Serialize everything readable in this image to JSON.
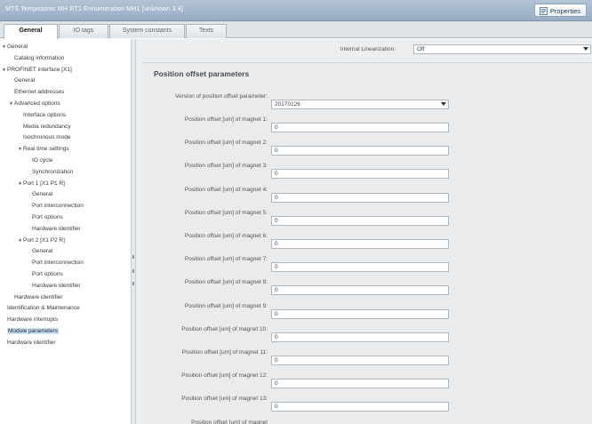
{
  "window": {
    "title": "MTS Temposonic MH RT1 Ennumeration MH1 [unknown 3.4]",
    "properties_label": "Properties",
    "properties_icon": "properties-icon"
  },
  "tabs": [
    {
      "label": "General",
      "active": true
    },
    {
      "label": "IO tags",
      "active": false
    },
    {
      "label": "System constants",
      "active": false
    },
    {
      "label": "Texts",
      "active": false
    }
  ],
  "nav": {
    "items": [
      {
        "label": "General",
        "toggle": "▼"
      },
      {
        "label": "Catalog information",
        "toggle": ""
      },
      {
        "label": "PROFINET interface [X1]",
        "toggle": "▼"
      },
      {
        "label": "General",
        "toggle": ""
      },
      {
        "label": "Ethernet addresses",
        "toggle": ""
      },
      {
        "label": "Advanced options",
        "toggle": "▼"
      },
      {
        "label": "Interface options",
        "toggle": ""
      },
      {
        "label": "Media redundancy",
        "toggle": ""
      },
      {
        "label": "Isochronous mode",
        "toggle": ""
      },
      {
        "label": "Real time settings",
        "toggle": "▼"
      },
      {
        "label": "IO cycle",
        "toggle": ""
      },
      {
        "label": "Synchronization",
        "toggle": ""
      },
      {
        "label": "Port 1 [X1 P1 R]",
        "toggle": "▼"
      },
      {
        "label": "General",
        "toggle": ""
      },
      {
        "label": "Port interconnection",
        "toggle": ""
      },
      {
        "label": "Port options",
        "toggle": ""
      },
      {
        "label": "Hardware identifier",
        "toggle": ""
      },
      {
        "label": "Port 2 [X1 P2 R]",
        "toggle": "▼"
      },
      {
        "label": "General",
        "toggle": ""
      },
      {
        "label": "Port interconnection",
        "toggle": ""
      },
      {
        "label": "Port options",
        "toggle": ""
      },
      {
        "label": "Hardware identifier",
        "toggle": ""
      },
      {
        "label": "Hardware identifier",
        "toggle": ""
      },
      {
        "label": "Identification & Maintenance",
        "toggle": ""
      },
      {
        "label": "Hardware interrupts",
        "toggle": ""
      },
      {
        "label": "Module parameters",
        "toggle": "",
        "selected": true
      },
      {
        "label": "Hardware identifier",
        "toggle": ""
      }
    ]
  },
  "internal_linearization": {
    "label": "Internal Linearization:",
    "value": "Off"
  },
  "section": {
    "title": "Position offset parameters"
  },
  "version": {
    "label": "Version of position offset parameter:",
    "value": "20170126"
  },
  "offsets": [
    {
      "label": "Position offset [um] of magnet 1:",
      "value": "0"
    },
    {
      "label": "Position offset [um] of magnet 2:",
      "value": "0"
    },
    {
      "label": "Position offset [um] of magnet 3:",
      "value": "0"
    },
    {
      "label": "Position offset [um] of magnet 4:",
      "value": "0"
    },
    {
      "label": "Position offset [um] of magnet 5:",
      "value": "0"
    },
    {
      "label": "Position offset [um] of magnet 6:",
      "value": "0"
    },
    {
      "label": "Position offset [um] of magnet 7:",
      "value": "0"
    },
    {
      "label": "Position offset [um] of magnet 8:",
      "value": "0"
    },
    {
      "label": "Position offset [um] of magnet 9:",
      "value": "0"
    },
    {
      "label": "Position offset [um] of magnet 10:",
      "value": "0"
    },
    {
      "label": "Position offset [um] of magnet 11:",
      "value": "0"
    },
    {
      "label": "Position offset [um] of magnet 12:",
      "value": "0"
    },
    {
      "label": "Position offset [um] of magnet 13:",
      "value": "0"
    },
    {
      "label": "Position offset [um] of magnet",
      "value": ""
    }
  ]
}
